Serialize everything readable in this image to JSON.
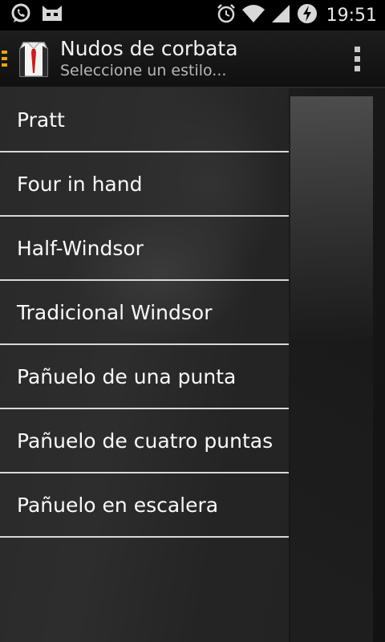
{
  "status_bar": {
    "time": "19:51",
    "icons": [
      "whatsapp-icon",
      "cyanogen-icon",
      "alarm-icon",
      "wifi-icon",
      "signal-icon",
      "battery-charging-icon"
    ]
  },
  "action_bar": {
    "title": "Nudos de corbata",
    "subtitle": "Seleccione un estilo...",
    "accent_color": "#f0a30a"
  },
  "drawer": {
    "items": [
      {
        "label": "Pratt"
      },
      {
        "label": "Four in hand"
      },
      {
        "label": "Half-Windsor"
      },
      {
        "label": "Tradicional Windsor"
      },
      {
        "label": "Pañuelo de una punta"
      },
      {
        "label": "Pañuelo de cuatro puntas"
      },
      {
        "label": "Pañuelo en escalera"
      }
    ]
  }
}
